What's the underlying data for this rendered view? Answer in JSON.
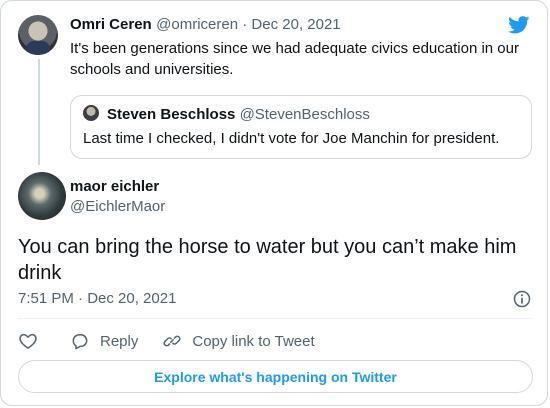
{
  "parent_tweet": {
    "name": "Omri Ceren",
    "handle": "@omriceren",
    "separator": " · ",
    "date": "Dec 20, 2021",
    "text": "It's been generations since we had adequate civics education in our schools and universities."
  },
  "quoted_tweet": {
    "name": "Steven Beschloss",
    "handle": "@StevenBeschloss",
    "text": "Last time I checked, I didn't vote for Joe Manchin for president."
  },
  "main_tweet": {
    "name": "maor eichler",
    "handle": "@EichlerMaor",
    "text": "You can bring the horse to water but you can’t make him drink",
    "time": "7:51 PM · Dec 20, 2021"
  },
  "actions": {
    "reply_label": "Reply",
    "copy_link_label": "Copy link to Tweet"
  },
  "footer": {
    "explore_label": "Explore what's happening on Twitter"
  },
  "icons": {
    "brand": "twitter-bird-icon",
    "like": "heart-icon",
    "reply": "reply-bubble-icon",
    "copy": "link-icon",
    "info": "info-icon"
  },
  "colors": {
    "accent": "#1d9bf0",
    "muted_text": "#536471",
    "border": "#cfd9de"
  }
}
